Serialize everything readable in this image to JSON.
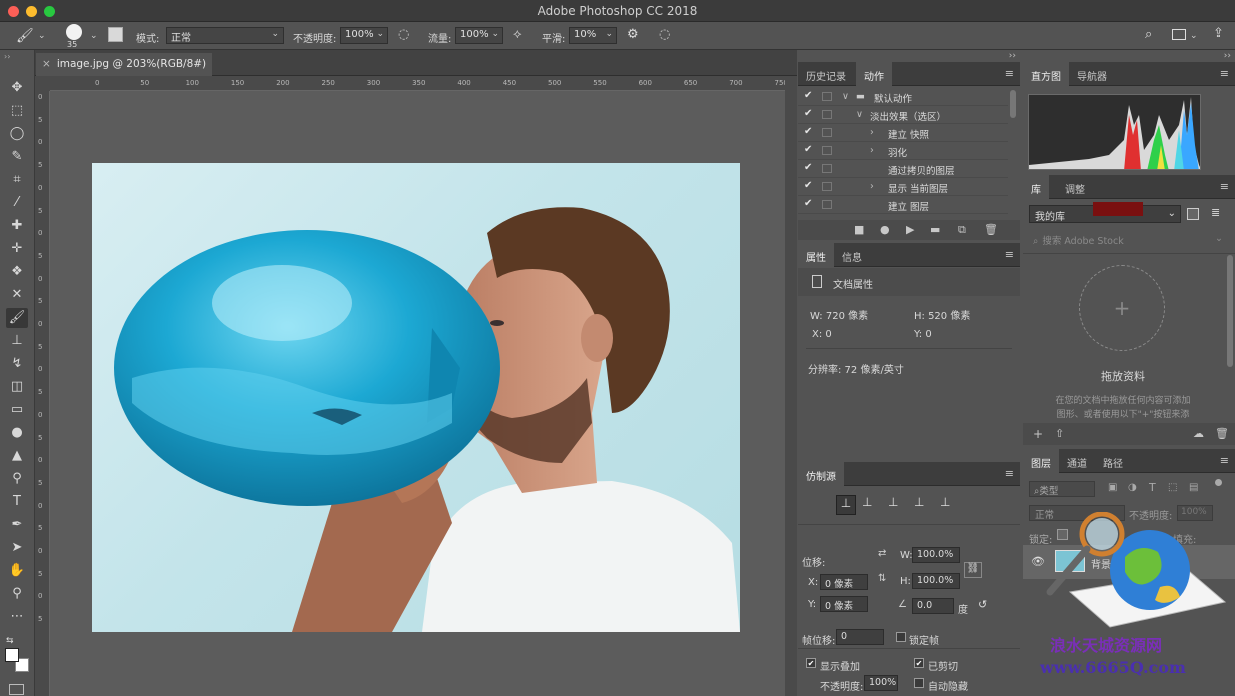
{
  "titlebar": {
    "title": "Adobe Photoshop CC 2018"
  },
  "options": {
    "brush_size": "35",
    "mode_label": "模式:",
    "mode_value": "正常",
    "opacity_label": "不透明度:",
    "opacity_value": "100%",
    "flow_label": "流量:",
    "flow_value": "100%",
    "smoothing_label": "平滑:",
    "smoothing_value": "10%"
  },
  "document": {
    "tab_label": "image.jpg @ 203%(RGB/8#)"
  },
  "ruler": {
    "h_ticks": [
      "0",
      "50",
      "100",
      "150",
      "200",
      "250",
      "300",
      "350",
      "400",
      "450",
      "500",
      "550",
      "600",
      "650",
      "700",
      "750"
    ],
    "v_ticks": [
      "0",
      "5",
      "0",
      "5",
      "0",
      "5",
      "0",
      "5",
      "0",
      "5",
      "0",
      "5",
      "0",
      "5",
      "0",
      "5",
      "0",
      "5",
      "0",
      "5",
      "0",
      "5",
      "0",
      "5"
    ]
  },
  "actions_panel": {
    "tabs": [
      "历史记录",
      "动作"
    ],
    "rows": [
      {
        "label": "默认动作",
        "indent": 0,
        "expand": "∨",
        "folder": true
      },
      {
        "label": "淡出效果（选区）",
        "indent": 1,
        "expand": "∨",
        "folder": false
      },
      {
        "label": "建立 快照",
        "indent": 2,
        "expand": "›",
        "folder": false
      },
      {
        "label": "羽化",
        "indent": 2,
        "expand": "›",
        "folder": false
      },
      {
        "label": "通过拷贝的图层",
        "indent": 2,
        "expand": "",
        "folder": false
      },
      {
        "label": "显示 当前图层",
        "indent": 2,
        "expand": "›",
        "folder": false
      },
      {
        "label": "建立 图层",
        "indent": 2,
        "expand": "",
        "folder": false
      }
    ]
  },
  "properties_panel": {
    "tabs": [
      "属性",
      "信息"
    ],
    "heading": "文档属性",
    "width_label": "W:  720 像素",
    "height_label": "H:  520 像素",
    "x_label": "X:  0",
    "y_label": "Y:  0",
    "resolution": "分辨率: 72 像素/英寸"
  },
  "clone_panel": {
    "tab": "仿制源",
    "offset_label": "位移:",
    "w_label": "W:",
    "w_value": "100.0%",
    "h_label": "H:",
    "h_value": "100.0%",
    "x_label": "X:",
    "x_value": "0 像素",
    "y_label": "Y:",
    "y_value": "0 像素",
    "angle_value": "0.0",
    "angle_unit": "度",
    "frame_offset_label": "帧位移:",
    "frame_offset_value": "0",
    "lock_frame": "锁定帧",
    "show_overlay": "显示叠加",
    "clipped": "已剪切",
    "opacity_label": "不透明度:",
    "opacity_value": "100%",
    "auto_hide": "自动隐藏"
  },
  "histogram_panel": {
    "tabs": [
      "直方图",
      "导航器"
    ]
  },
  "library_panel": {
    "tabs": [
      "库",
      "调整"
    ],
    "library_name": "我的库",
    "search_placeholder": "搜索 Adobe Stock",
    "drop_title": "拖放资料",
    "drop_desc_1": "在您的文档中拖放任何内容可添加",
    "drop_desc_2": "图形、或者使用以下\"+\"按钮来添"
  },
  "layers_panel": {
    "tabs": [
      "图层",
      "通道",
      "路径"
    ],
    "filter_type": "类型",
    "blend_mode": "正常",
    "opacity_label": "不透明度:",
    "opacity_value": "100%",
    "lock_label": "锁定:",
    "fill_label": "填充:",
    "layer_name": "背景"
  },
  "watermark": {
    "line1": "浪水天城资源网",
    "line2": "www.6665Q.com"
  },
  "colors": {
    "bg": "#535353",
    "panel_tab": "#3d3d3d",
    "accent": "#2b9fc7"
  }
}
